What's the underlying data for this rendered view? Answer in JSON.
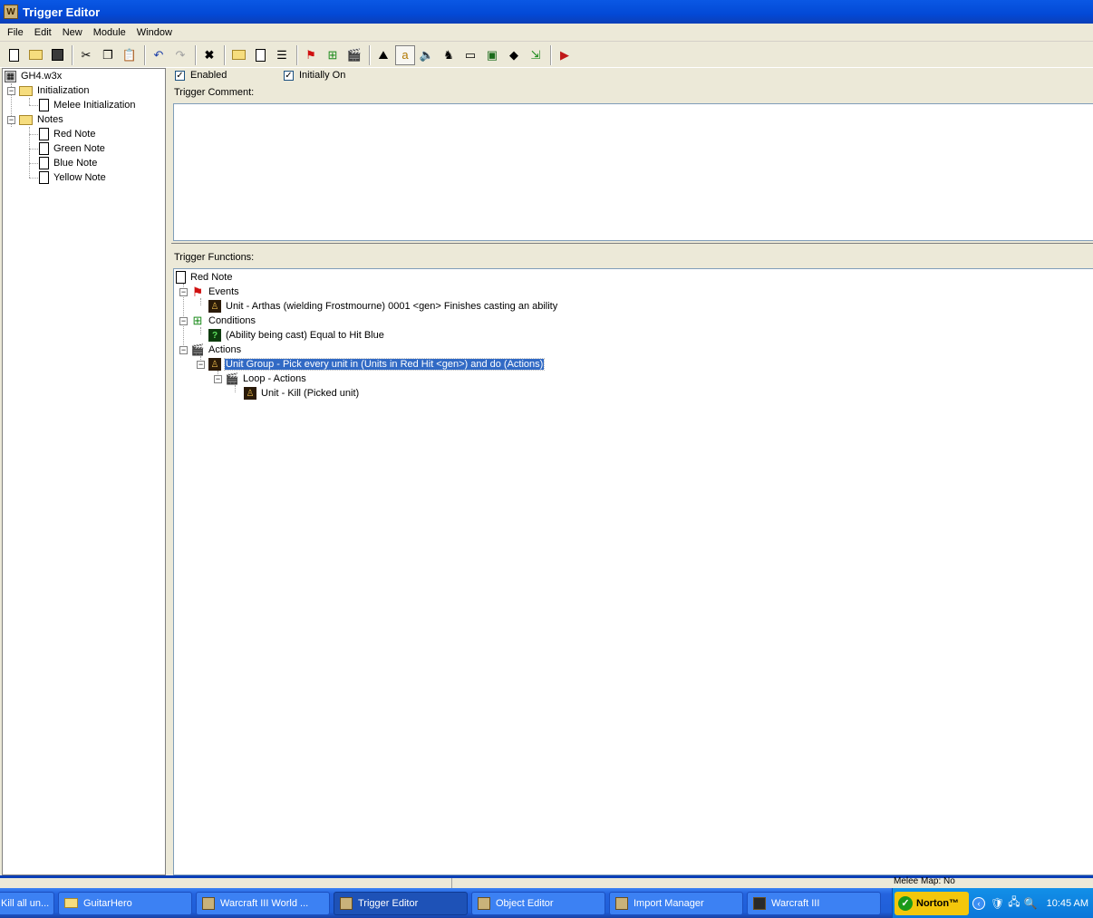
{
  "window": {
    "title": "Trigger Editor"
  },
  "menu": [
    "File",
    "Edit",
    "New",
    "Module",
    "Window"
  ],
  "toolbar": {
    "icons": [
      "new-icon",
      "open-icon",
      "save-icon",
      "cut-icon",
      "copy-icon",
      "paste-icon",
      "undo-icon",
      "redo-icon",
      "delete-icon",
      "new-category-icon",
      "new-trigger-icon",
      "new-comment-icon",
      "new-event-icon",
      "new-condition-icon",
      "new-action-icon",
      "terrain-editor-icon",
      "trigger-editor-icon",
      "sound-editor-icon",
      "object-editor-icon",
      "campaign-editor-icon",
      "ai-editor-icon",
      "object-manager-icon",
      "import-manager-icon",
      "test-map-icon"
    ]
  },
  "tree": {
    "root": "GH4.w3x",
    "categories": [
      {
        "label": "Initialization",
        "items": [
          "Melee Initialization"
        ]
      },
      {
        "label": "Notes",
        "items": [
          "Red Note",
          "Green Note",
          "Blue Note",
          "Yellow Note"
        ]
      }
    ]
  },
  "trigger": {
    "enabled_label": "Enabled",
    "enabled": true,
    "initially_on_label": "Initially On",
    "initially_on": true,
    "comment_label": "Trigger Comment:",
    "comment": "",
    "functions_label": "Trigger Functions:"
  },
  "functions": {
    "name": "Red Note",
    "events_label": "Events",
    "event": "Unit - Arthas (wielding Frostmourne) 0001 <gen> Finishes casting an ability",
    "conditions_label": "Conditions",
    "condition": "(Ability being cast) Equal to Hit Blue",
    "actions_label": "Actions",
    "action": "Unit Group - Pick every unit in (Units in Red Hit <gen>) and do (Actions)",
    "loop_label": "Loop - Actions",
    "loop_action": "Unit - Kill (Picked unit)"
  },
  "status": {
    "melee_map": "Melee Map: No"
  },
  "taskbar": {
    "tasks": [
      "Kill all un...",
      "GuitarHero",
      "Warcraft III World ...",
      "Trigger Editor",
      "Object Editor",
      "Import Manager",
      "Warcraft III"
    ],
    "active": "Trigger Editor",
    "norton": "Norton™",
    "clock": "10:45 AM"
  },
  "colors": {
    "selection": "#316ac5",
    "titlebar": "#0a58e4",
    "taskbar": "#2463de",
    "tray": "#0b76d9",
    "norton": "#f3c70b"
  }
}
